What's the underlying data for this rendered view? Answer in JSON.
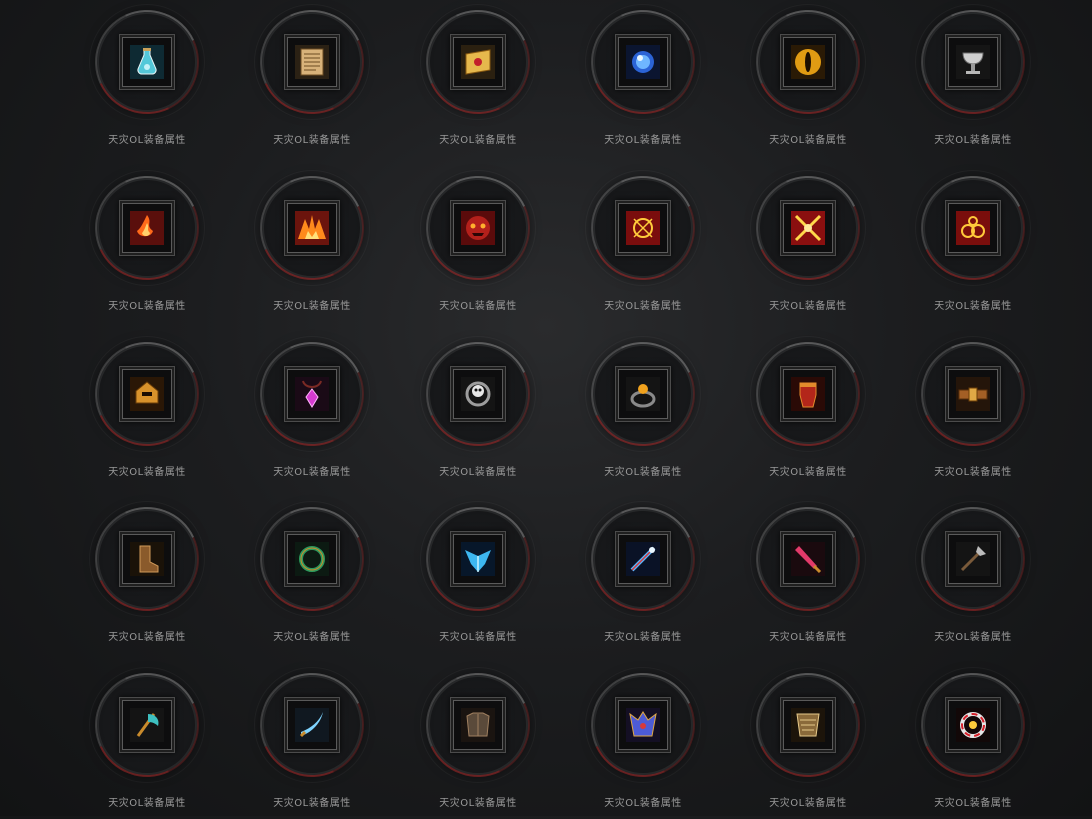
{
  "items": [
    {
      "label": "天灾OL装备属性",
      "icon": "potion-bottle-icon"
    },
    {
      "label": "天灾OL装备属性",
      "icon": "scroll-book-icon"
    },
    {
      "label": "天灾OL装备属性",
      "icon": "letter-seal-icon"
    },
    {
      "label": "天灾OL装备属性",
      "icon": "blue-orb-icon"
    },
    {
      "label": "天灾OL装备属性",
      "icon": "golden-eye-icon"
    },
    {
      "label": "天灾OL装备属性",
      "icon": "grail-chalice-icon"
    },
    {
      "label": "天灾OL装备属性",
      "icon": "fire-rune-icon"
    },
    {
      "label": "天灾OL装备属性",
      "icon": "flame-burst-icon"
    },
    {
      "label": "天灾OL装备属性",
      "icon": "demon-face-icon"
    },
    {
      "label": "天灾OL装备属性",
      "icon": "red-sigil-icon"
    },
    {
      "label": "天灾OL装备属性",
      "icon": "crossed-blades-icon"
    },
    {
      "label": "天灾OL装备属性",
      "icon": "spiral-rune-icon"
    },
    {
      "label": "天灾OL装备属性",
      "icon": "golden-helm-icon"
    },
    {
      "label": "天灾OL装备属性",
      "icon": "purple-amulet-icon"
    },
    {
      "label": "天灾OL装备属性",
      "icon": "skull-ring-icon"
    },
    {
      "label": "天灾OL装备属性",
      "icon": "amber-ring-icon"
    },
    {
      "label": "天灾OL装备属性",
      "icon": "red-gauntlet-icon"
    },
    {
      "label": "天灾OL装备属性",
      "icon": "bronze-belt-icon"
    },
    {
      "label": "天灾OL装备属性",
      "icon": "leather-boots-icon"
    },
    {
      "label": "天灾OL装备属性",
      "icon": "jade-ring-icon"
    },
    {
      "label": "天灾OL装备属性",
      "icon": "blue-wing-icon"
    },
    {
      "label": "天灾OL装备属性",
      "icon": "crystal-wand-icon"
    },
    {
      "label": "天灾OL装备属性",
      "icon": "red-dagger-icon"
    },
    {
      "label": "天灾OL装备属性",
      "icon": "dark-spear-icon"
    },
    {
      "label": "天灾OL装备属性",
      "icon": "battle-axe-icon"
    },
    {
      "label": "天灾OL装备属性",
      "icon": "curved-blade-icon"
    },
    {
      "label": "天灾OL装备属性",
      "icon": "dark-armor-icon"
    },
    {
      "label": "天灾OL装备属性",
      "icon": "ornate-chest-icon"
    },
    {
      "label": "天灾OL装备属性",
      "icon": "bone-armor-icon"
    },
    {
      "label": "天灾OL装备属性",
      "icon": "crimson-ring-icon"
    }
  ]
}
